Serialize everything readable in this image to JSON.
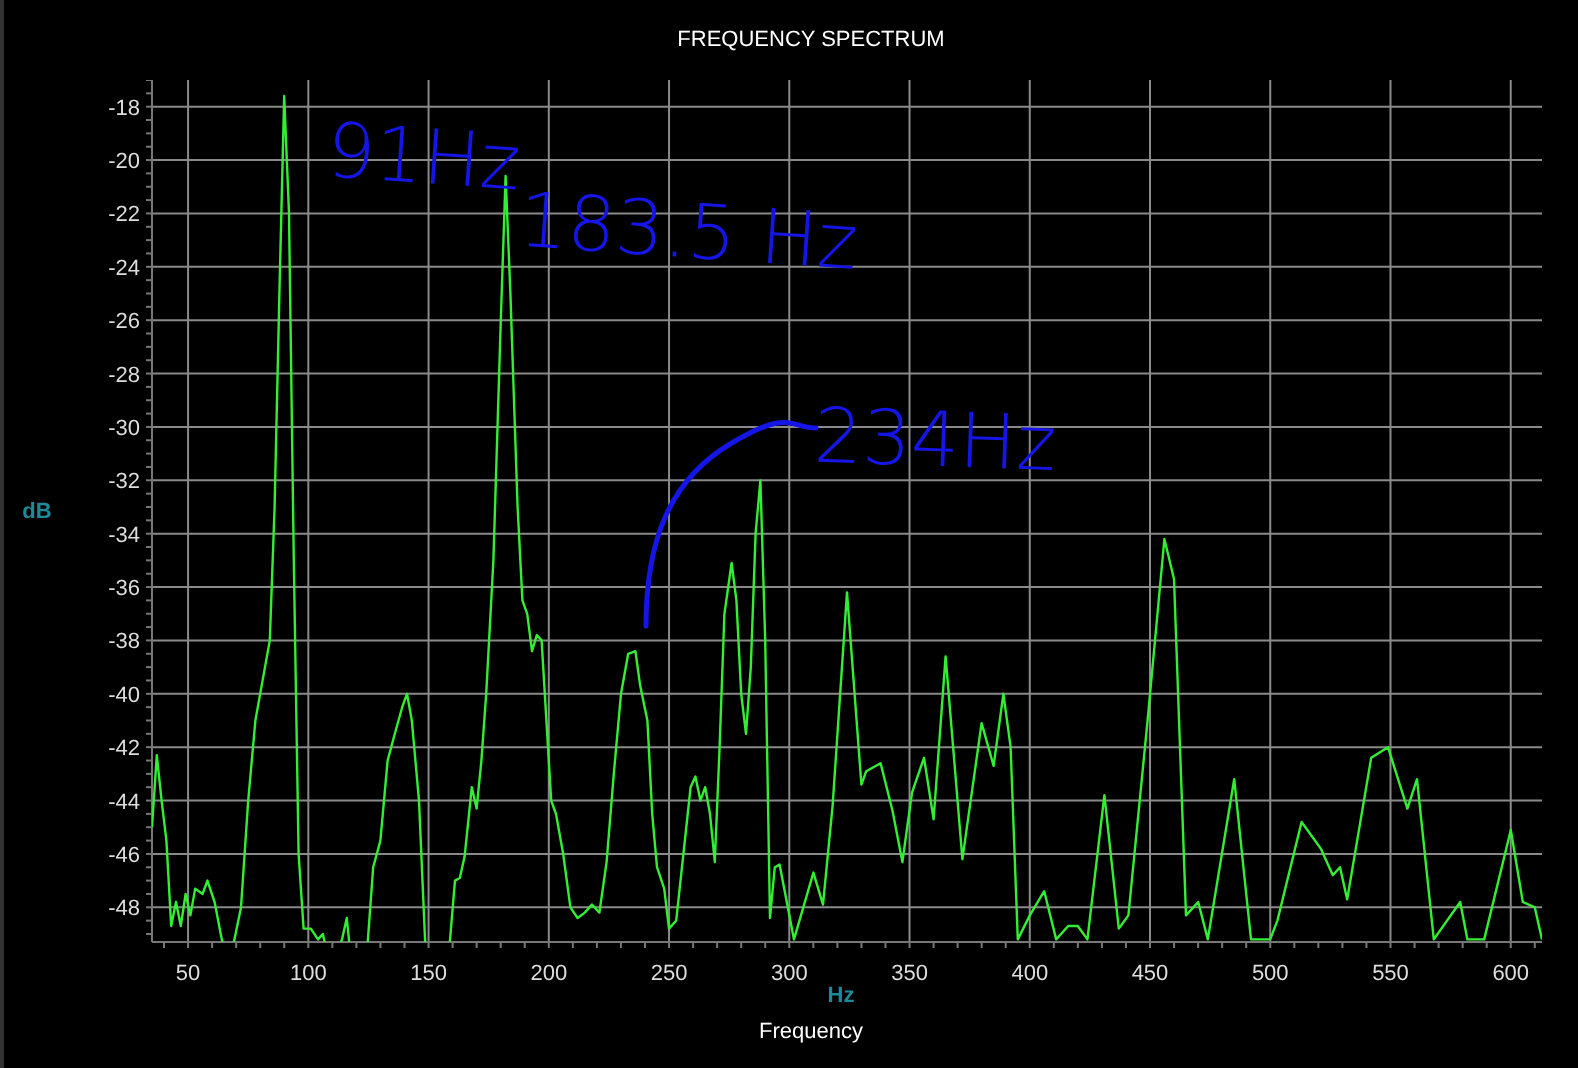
{
  "chart": {
    "x_unit_label": "Hz",
    "chart_data": {
      "type": "line",
      "title": "FREQUENCY SPECTRUM",
      "xlabel": "Frequency",
      "ylabel": "dB",
      "grid": true,
      "x": [
        35,
        37,
        39,
        41,
        43,
        45,
        47,
        49,
        51,
        53,
        56,
        58,
        61,
        64,
        67,
        72,
        75,
        78,
        81,
        84,
        86,
        88,
        90,
        92,
        94,
        96,
        98,
        101,
        104,
        106,
        109,
        114,
        116,
        118,
        124,
        127,
        130,
        133,
        136,
        139,
        141,
        143,
        146,
        149,
        158,
        161,
        163,
        165,
        168,
        170,
        172,
        174,
        177,
        180,
        182,
        184,
        187,
        189,
        191,
        193,
        195,
        197,
        199,
        201,
        203,
        206,
        209,
        212,
        215,
        218,
        221,
        224,
        227,
        230,
        233,
        236,
        238,
        241,
        243,
        245,
        248,
        250,
        253,
        256,
        259,
        261,
        263,
        265,
        267,
        269,
        271,
        273,
        276,
        278,
        280,
        282,
        284,
        286,
        288,
        290,
        292,
        294,
        296,
        302,
        310,
        314,
        318,
        324,
        330,
        332,
        338,
        343,
        347,
        351,
        356,
        360,
        365,
        372,
        380,
        385,
        389,
        392,
        395,
        400,
        406,
        411,
        416,
        420,
        424,
        431,
        437,
        441,
        449,
        456,
        460,
        465,
        470,
        474,
        485,
        492,
        500,
        503,
        513,
        521,
        526,
        529,
        532,
        542,
        549,
        557,
        561,
        568,
        579,
        582,
        589,
        600,
        605,
        610,
        613
      ],
      "series": [
        {
          "color": "#33ee33",
          "values": [
            -45,
            -42.3,
            -44,
            -45.5,
            -48.7,
            -47.8,
            -48.7,
            -47.5,
            -48.3,
            -47.3,
            -47.5,
            -47,
            -47.8,
            -49.2,
            null,
            -48,
            -44,
            -41,
            -39.5,
            -38,
            -33,
            -25,
            -17.6,
            -22,
            -35,
            -46,
            -48.8,
            -48.8,
            -49.2,
            -49,
            null,
            -49.2,
            -48.4,
            null,
            null,
            -46.5,
            -45.5,
            -42.5,
            -41.5,
            -40.5,
            -40,
            -41,
            -44,
            null,
            null,
            -47,
            -46.9,
            -46.1,
            -43.5,
            -44.3,
            -42.5,
            -40,
            -35,
            -26,
            -20.6,
            -25,
            -33,
            -36.5,
            -37,
            -38.4,
            -37.8,
            -38,
            -41,
            -44,
            -44.5,
            -46,
            -48,
            -48.4,
            -48.2,
            -47.9,
            -48.2,
            -46.3,
            -43,
            -40,
            -38.5,
            -38.4,
            -39.7,
            -41,
            -44.5,
            -46.5,
            -47.3,
            -48.8,
            -48.5,
            -46,
            -43.5,
            -43.1,
            -44,
            -43.5,
            -44.5,
            -46.3,
            -42,
            -37,
            -35.1,
            -36.5,
            -40,
            -41.5,
            -39,
            -34,
            -32,
            -38,
            -48.4,
            -46.5,
            -46.4,
            -49.2,
            -46.7,
            -47.9,
            -44.2,
            -36.2,
            -43.4,
            -42.9,
            -42.6,
            -44.4,
            -46.3,
            -43.7,
            -42.4,
            -44.7,
            -38.6,
            -46.2,
            -41.1,
            -42.7,
            -40,
            -42,
            -49.2,
            -48.3,
            -47.4,
            -49.2,
            -48.7,
            -48.7,
            -49.2,
            -43.8,
            -48.8,
            -48.3,
            -41,
            -34.2,
            -35.7,
            -48.3,
            -47.8,
            -49.2,
            -43.2,
            -49.2,
            -49.2,
            -48.5,
            -44.8,
            -45.8,
            -46.8,
            -46.5,
            -47.7,
            -42.4,
            -42,
            -44.3,
            -43.2,
            -49.2,
            -47.8,
            -49.2,
            -49.2,
            -45.1,
            -47.8,
            -48,
            -49.2
          ]
        }
      ],
      "xlim": [
        35,
        613
      ],
      "ylim": [
        -49.3,
        -17
      ],
      "xticks": [
        50,
        100,
        150,
        200,
        250,
        300,
        350,
        400,
        450,
        500,
        550,
        600
      ],
      "yticks": [
        -18,
        -20,
        -22,
        -24,
        -26,
        -28,
        -30,
        -32,
        -34,
        -36,
        -38,
        -40,
        -42,
        -44,
        -46,
        -48
      ],
      "annotations": [
        "91Hz",
        "183.5 Hz",
        "234Hz"
      ]
    }
  }
}
